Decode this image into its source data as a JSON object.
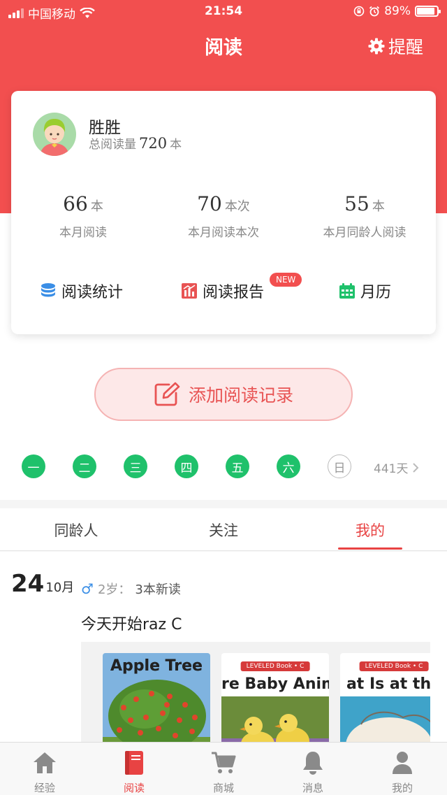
{
  "status_bar": {
    "carrier": "中国移动",
    "time": "21:54",
    "battery_pct": "89%",
    "battery_level": 0.89
  },
  "nav": {
    "title": "阅读",
    "remind_label": "提醒"
  },
  "profile": {
    "name": "胜胜",
    "total_label": "总阅读量",
    "total_value": "720",
    "total_unit": "本"
  },
  "stats": [
    {
      "value": "66",
      "unit": "本",
      "label": "本月阅读"
    },
    {
      "value": "70",
      "unit": "本次",
      "label": "本月阅读本次"
    },
    {
      "value": "55",
      "unit": "本",
      "label": "本月同龄人阅读"
    }
  ],
  "actions": {
    "stats_label": "阅读统计",
    "report_label": "阅读报告",
    "new_badge": "NEW",
    "calendar_label": "月历"
  },
  "add_record": {
    "label": "添加阅读记录"
  },
  "week": {
    "days": [
      "一",
      "二",
      "三",
      "四",
      "五",
      "六",
      "日"
    ],
    "checked": [
      true,
      true,
      true,
      true,
      true,
      true,
      false
    ],
    "streak": "441天"
  },
  "tabs": [
    "同龄人",
    "关注",
    "我的"
  ],
  "active_tab": "我的",
  "post": {
    "day": "24",
    "month": "10月",
    "gender_symbol": "♂",
    "age": "2岁：",
    "new_count": "3本新读",
    "text": "今天开始raz  C",
    "books": [
      {
        "title": "Apple Tree",
        "banner": ""
      },
      {
        "title": "re Baby Anim",
        "banner": "LEVELED Book • C"
      },
      {
        "title": "at Is at the",
        "banner": "LEVELED Book • C"
      }
    ]
  },
  "tabbar": [
    {
      "label": "经验",
      "icon": "home-icon"
    },
    {
      "label": "阅读",
      "icon": "book-icon"
    },
    {
      "label": "商城",
      "icon": "cart-icon"
    },
    {
      "label": "消息",
      "icon": "bell-icon"
    },
    {
      "label": "我的",
      "icon": "person-icon"
    }
  ],
  "colors": {
    "brand_red": "#f24f4f",
    "check_green": "#1fc16b",
    "stats_blue": "#3a8ee6"
  }
}
